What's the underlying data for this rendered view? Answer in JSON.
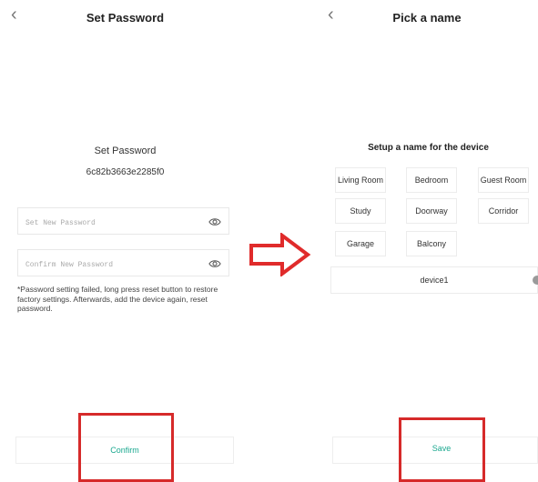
{
  "left_screen": {
    "title": "Set Password",
    "heading": "Set Password",
    "device_id": "6c82b3663e2285f0",
    "new_password": {
      "placeholder": "Set New Password",
      "value": ""
    },
    "confirm_password": {
      "placeholder": "Confirm New Password",
      "value": ""
    },
    "note": "*Password setting failed, long press reset button to restore factory settings. Afterwards, add the device again, reset password.",
    "confirm_label": "Confirm",
    "icons": {
      "back": "chevron-left-icon",
      "visibility": "eye-icon"
    }
  },
  "right_screen": {
    "title": "Pick a name",
    "heading": "Setup a name for the device",
    "room_options": [
      "Living Room",
      "Bedroom",
      "Guest Room",
      "Study",
      "Doorway",
      "Corridor",
      "Garage",
      "Balcony"
    ],
    "device_name": "device1",
    "save_label": "Save",
    "icons": {
      "back": "chevron-left-icon",
      "clear": "clear-icon"
    }
  },
  "colors": {
    "accent": "#1aa88f",
    "highlight": "#d62a2a",
    "flow_arrow": "#e02b2b"
  }
}
